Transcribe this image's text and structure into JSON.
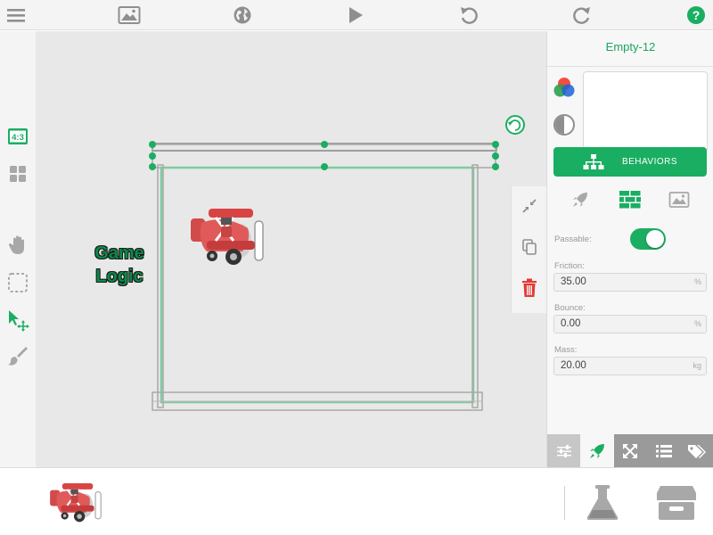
{
  "object": {
    "title": "Empty-12",
    "behaviors_label": "BEHAVIORS"
  },
  "canvas": {
    "scene_label_line1": "Game",
    "scene_label_line2": "Logic",
    "aspect_label": "4:3"
  },
  "physics": {
    "passable_label": "Passable:",
    "passable_on": true,
    "friction_label": "Friction:",
    "friction_value": "35.00",
    "friction_unit": "%",
    "bounce_label": "Bounce:",
    "bounce_value": "0.00",
    "bounce_unit": "%",
    "mass_label": "Mass:",
    "mass_value": "20.00",
    "mass_unit": "kg"
  },
  "colors": {
    "accent": "#1aae62",
    "delete": "#e53935",
    "icon_gray": "#9a9a9a"
  },
  "icons": {
    "toolbar": [
      "menu-icon",
      "image-icon",
      "globe-icon",
      "play-icon",
      "undo-icon",
      "redo-icon",
      "help-icon"
    ],
    "left_tools": [
      "aspect-ratio-icon",
      "grid-icon",
      "hand-icon",
      "select-area-icon",
      "move-pointer-icon",
      "brush-icon"
    ],
    "floating": [
      "shrink-icon",
      "duplicate-icon",
      "trash-icon"
    ],
    "subtabs": [
      "rocket-icon",
      "brick-wall-icon",
      "image-icon"
    ],
    "bottom_tabs": [
      "sliders-icon",
      "rocket-icon",
      "expand-icon",
      "list-icon",
      "tags-icon"
    ],
    "tray": [
      "flask-icon",
      "archive-icon"
    ]
  }
}
